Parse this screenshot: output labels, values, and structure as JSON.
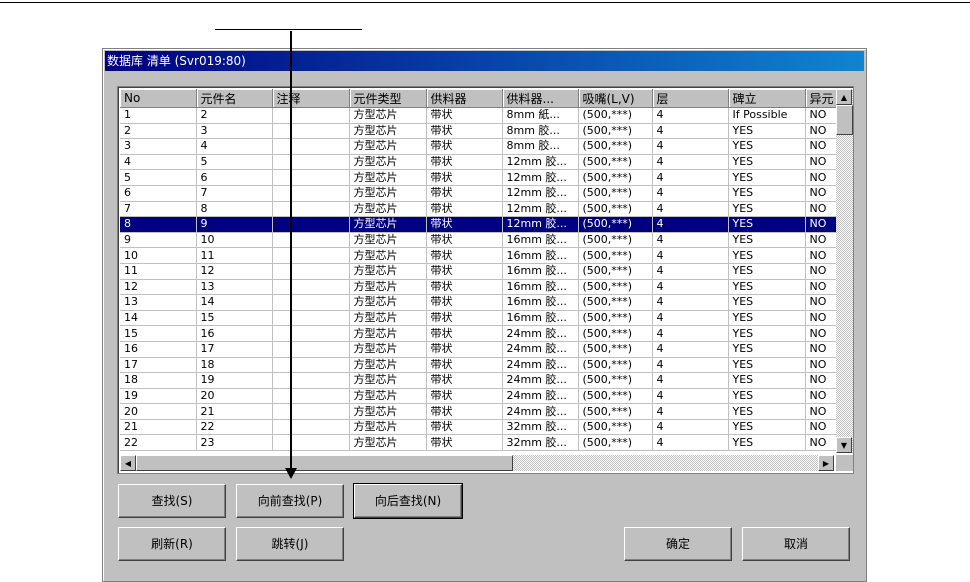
{
  "dialog": {
    "title": "数据库 清单 (Svr019:80)"
  },
  "table": {
    "columns": [
      "No",
      "元件名",
      "注释",
      "元件类型",
      "供料器",
      "供料器...",
      "吸嘴(L,V)",
      "层",
      "碑立",
      "异元"
    ],
    "selected_row": 8,
    "rows": [
      [
        "1",
        "2",
        "",
        "方型芯片",
        "带状",
        "8mm 紙...",
        "(500,***)",
        "4",
        "If Possible",
        "NO"
      ],
      [
        "2",
        "3",
        "",
        "方型芯片",
        "带状",
        "8mm 胶...",
        "(500,***)",
        "4",
        "YES",
        "NO"
      ],
      [
        "3",
        "4",
        "",
        "方型芯片",
        "带状",
        "8mm 胶...",
        "(500,***)",
        "4",
        "YES",
        "NO"
      ],
      [
        "4",
        "5",
        "",
        "方型芯片",
        "带状",
        "12mm 胶...",
        "(500,***)",
        "4",
        "YES",
        "NO"
      ],
      [
        "5",
        "6",
        "",
        "方型芯片",
        "带状",
        "12mm 胶...",
        "(500,***)",
        "4",
        "YES",
        "NO"
      ],
      [
        "6",
        "7",
        "",
        "方型芯片",
        "带状",
        "12mm 胶...",
        "(500,***)",
        "4",
        "YES",
        "NO"
      ],
      [
        "7",
        "8",
        "",
        "方型芯片",
        "带状",
        "12mm 胶...",
        "(500,***)",
        "4",
        "YES",
        "NO"
      ],
      [
        "8",
        "9",
        "",
        "方型芯片",
        "带状",
        "12mm 胶...",
        "(500,***)",
        "4",
        "YES",
        "NO"
      ],
      [
        "9",
        "10",
        "",
        "方型芯片",
        "带状",
        "16mm 胶...",
        "(500,***)",
        "4",
        "YES",
        "NO"
      ],
      [
        "10",
        "11",
        "",
        "方型芯片",
        "带状",
        "16mm 胶...",
        "(500,***)",
        "4",
        "YES",
        "NO"
      ],
      [
        "11",
        "12",
        "",
        "方型芯片",
        "带状",
        "16mm 胶...",
        "(500,***)",
        "4",
        "YES",
        "NO"
      ],
      [
        "12",
        "13",
        "",
        "方型芯片",
        "带状",
        "16mm 胶...",
        "(500,***)",
        "4",
        "YES",
        "NO"
      ],
      [
        "13",
        "14",
        "",
        "方型芯片",
        "带状",
        "16mm 胶...",
        "(500,***)",
        "4",
        "YES",
        "NO"
      ],
      [
        "14",
        "15",
        "",
        "方型芯片",
        "带状",
        "16mm 胶...",
        "(500,***)",
        "4",
        "YES",
        "NO"
      ],
      [
        "15",
        "16",
        "",
        "方型芯片",
        "带状",
        "24mm 胶...",
        "(500,***)",
        "4",
        "YES",
        "NO"
      ],
      [
        "16",
        "17",
        "",
        "方型芯片",
        "带状",
        "24mm 胶...",
        "(500,***)",
        "4",
        "YES",
        "NO"
      ],
      [
        "17",
        "18",
        "",
        "方型芯片",
        "带状",
        "24mm 胶...",
        "(500,***)",
        "4",
        "YES",
        "NO"
      ],
      [
        "18",
        "19",
        "",
        "方型芯片",
        "带状",
        "24mm 胶...",
        "(500,***)",
        "4",
        "YES",
        "NO"
      ],
      [
        "19",
        "20",
        "",
        "方型芯片",
        "带状",
        "24mm 胶...",
        "(500,***)",
        "4",
        "YES",
        "NO"
      ],
      [
        "20",
        "21",
        "",
        "方型芯片",
        "带状",
        "24mm 胶...",
        "(500,***)",
        "4",
        "YES",
        "NO"
      ],
      [
        "21",
        "22",
        "",
        "方型芯片",
        "带状",
        "32mm 胶...",
        "(500,***)",
        "4",
        "YES",
        "NO"
      ],
      [
        "22",
        "23",
        "",
        "方型芯片",
        "带状",
        "32mm 胶...",
        "(500,***)",
        "4",
        "YES",
        "NO"
      ]
    ]
  },
  "buttons": {
    "search": "查找(S)",
    "search_prev": "向前查找(P)",
    "search_next": "向后查找(N)",
    "refresh": "刷新(R)",
    "jump": "跳转(J)",
    "ok": "确定",
    "cancel": "取消"
  },
  "icons": {
    "up": "▲",
    "down": "▼",
    "left": "◀",
    "right": "▶"
  }
}
